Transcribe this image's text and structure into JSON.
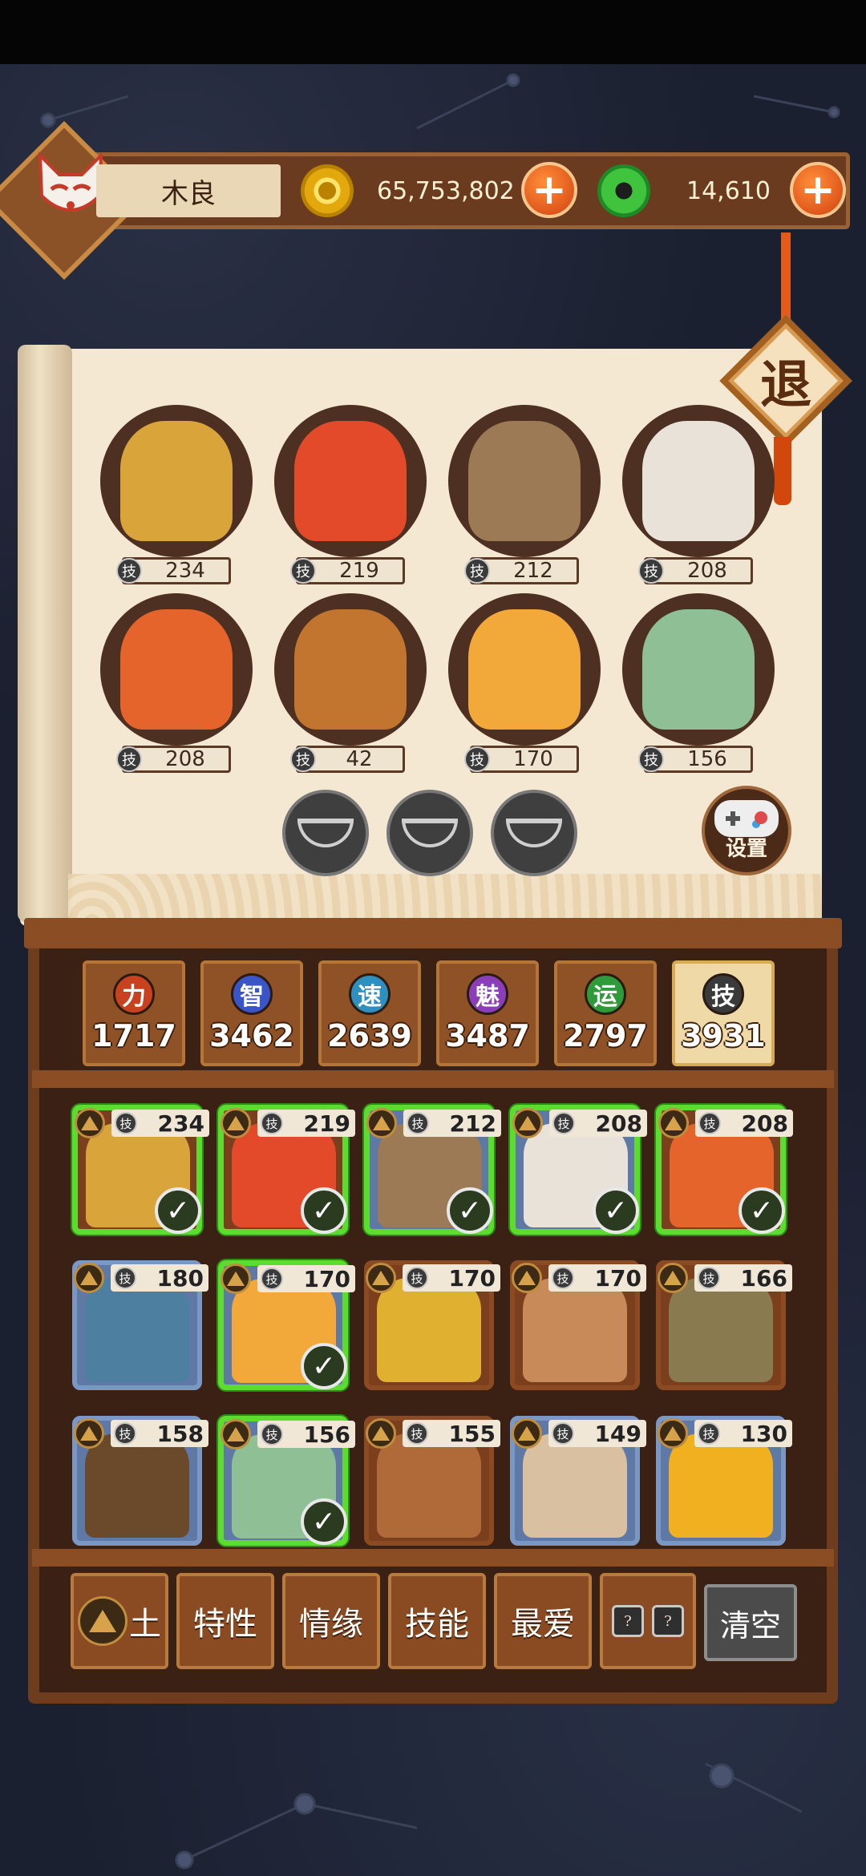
{
  "player": {
    "name": "木良",
    "gold": "65,753,802",
    "jade": "14,610"
  },
  "exit_label": "退",
  "team": [
    {
      "skill": "234",
      "color": "#d9a43a"
    },
    {
      "skill": "219",
      "color": "#e24a2a"
    },
    {
      "skill": "212",
      "color": "#9b7a55"
    },
    {
      "skill": "208",
      "color": "#e9e2d8"
    },
    {
      "skill": "208",
      "color": "#e5642c"
    },
    {
      "skill": "42",
      "color": "#c2752e"
    },
    {
      "skill": "170",
      "color": "#f2a93a"
    },
    {
      "skill": "156",
      "color": "#8fbf94"
    }
  ],
  "skill_glyph": "技",
  "gamepad_label": "设置",
  "stats": [
    {
      "glyph": "力",
      "value": "1717",
      "color": "#c8421f"
    },
    {
      "glyph": "智",
      "value": "3462",
      "color": "#3a55c8"
    },
    {
      "glyph": "速",
      "value": "2639",
      "color": "#2f8fbf"
    },
    {
      "glyph": "魅",
      "value": "3487",
      "color": "#8a3fb8"
    },
    {
      "glyph": "运",
      "value": "2797",
      "color": "#2f9a3a"
    },
    {
      "glyph": "技",
      "value": "3931",
      "color": "#3a3a3a"
    }
  ],
  "heroes": [
    {
      "skill": "234",
      "selected": true,
      "blue": false,
      "art": "#d9a43a"
    },
    {
      "skill": "219",
      "selected": true,
      "blue": false,
      "art": "#e24a2a"
    },
    {
      "skill": "212",
      "selected": true,
      "blue": true,
      "art": "#9b7a55"
    },
    {
      "skill": "208",
      "selected": true,
      "blue": true,
      "art": "#e9e2d8"
    },
    {
      "skill": "208",
      "selected": true,
      "blue": false,
      "art": "#e5642c"
    },
    {
      "skill": "180",
      "selected": false,
      "blue": true,
      "art": "#4d7fa0"
    },
    {
      "skill": "170",
      "selected": true,
      "blue": true,
      "art": "#f2a93a"
    },
    {
      "skill": "170",
      "selected": false,
      "blue": false,
      "art": "#e0b030"
    },
    {
      "skill": "170",
      "selected": false,
      "blue": false,
      "art": "#c98a5a"
    },
    {
      "skill": "166",
      "selected": false,
      "blue": false,
      "art": "#8a7a50"
    },
    {
      "skill": "158",
      "selected": false,
      "blue": true,
      "art": "#6a4a2a"
    },
    {
      "skill": "156",
      "selected": true,
      "blue": true,
      "art": "#8fbf94"
    },
    {
      "skill": "155",
      "selected": false,
      "blue": false,
      "art": "#b06a3a"
    },
    {
      "skill": "149",
      "selected": false,
      "blue": true,
      "art": "#d8c0a0"
    },
    {
      "skill": "130",
      "selected": false,
      "blue": true,
      "art": "#f0b020"
    }
  ],
  "filters": {
    "earth": "土",
    "trait": "特性",
    "bond": "情缘",
    "skill": "技能",
    "favorite": "最爱",
    "unknown_mark": "?",
    "clear": "清空"
  }
}
